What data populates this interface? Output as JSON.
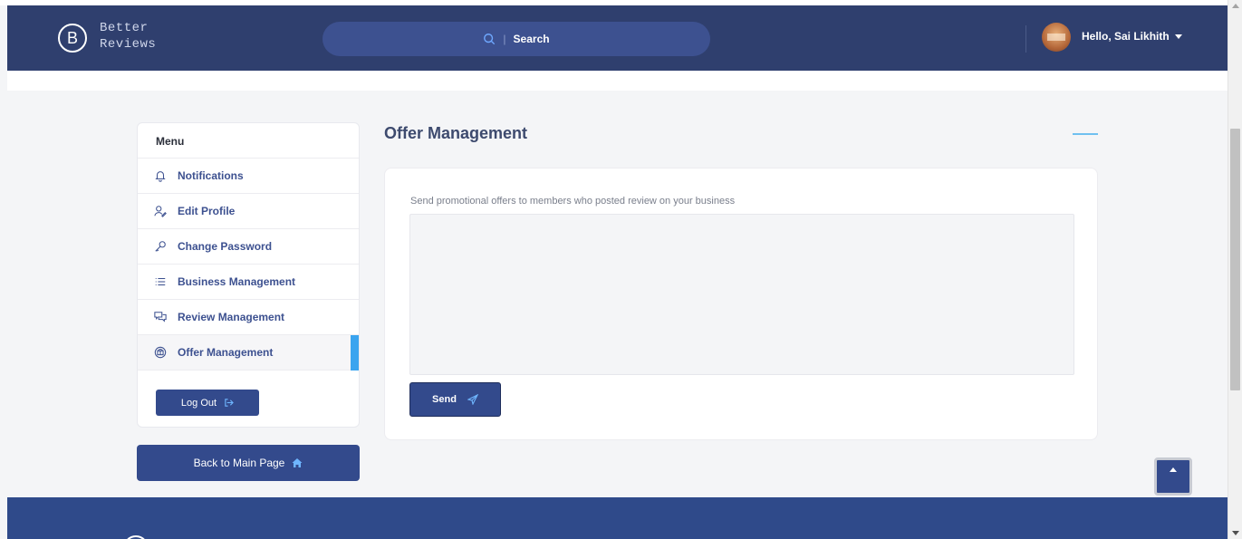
{
  "header": {
    "logo_letter": "B",
    "logo_line1": "Better",
    "logo_line2": "Reviews",
    "search_placeholder": "Search",
    "search_separator": "|",
    "greeting": "Hello, Sai Likhith"
  },
  "sidebar": {
    "title": "Menu",
    "items": [
      {
        "label": "Notifications",
        "icon": "bell-icon"
      },
      {
        "label": "Edit Profile",
        "icon": "user-edit-icon"
      },
      {
        "label": "Change Password",
        "icon": "key-icon"
      },
      {
        "label": "Business Management",
        "icon": "list-icon"
      },
      {
        "label": "Review Management",
        "icon": "chat-icon"
      },
      {
        "label": "Offer Management",
        "icon": "offer-icon",
        "active": true
      }
    ],
    "logout_label": "Log Out",
    "back_label": "Back to Main Page"
  },
  "main": {
    "title": "Offer Management",
    "description": "Send promotional offers to members who posted review on your business",
    "textarea_value": "",
    "send_label": "Send"
  },
  "colors": {
    "header_bg": "#2f3f6e",
    "primary": "#334a8c",
    "accent": "#3aa4ef",
    "footer_bg": "#2f4a8a"
  }
}
